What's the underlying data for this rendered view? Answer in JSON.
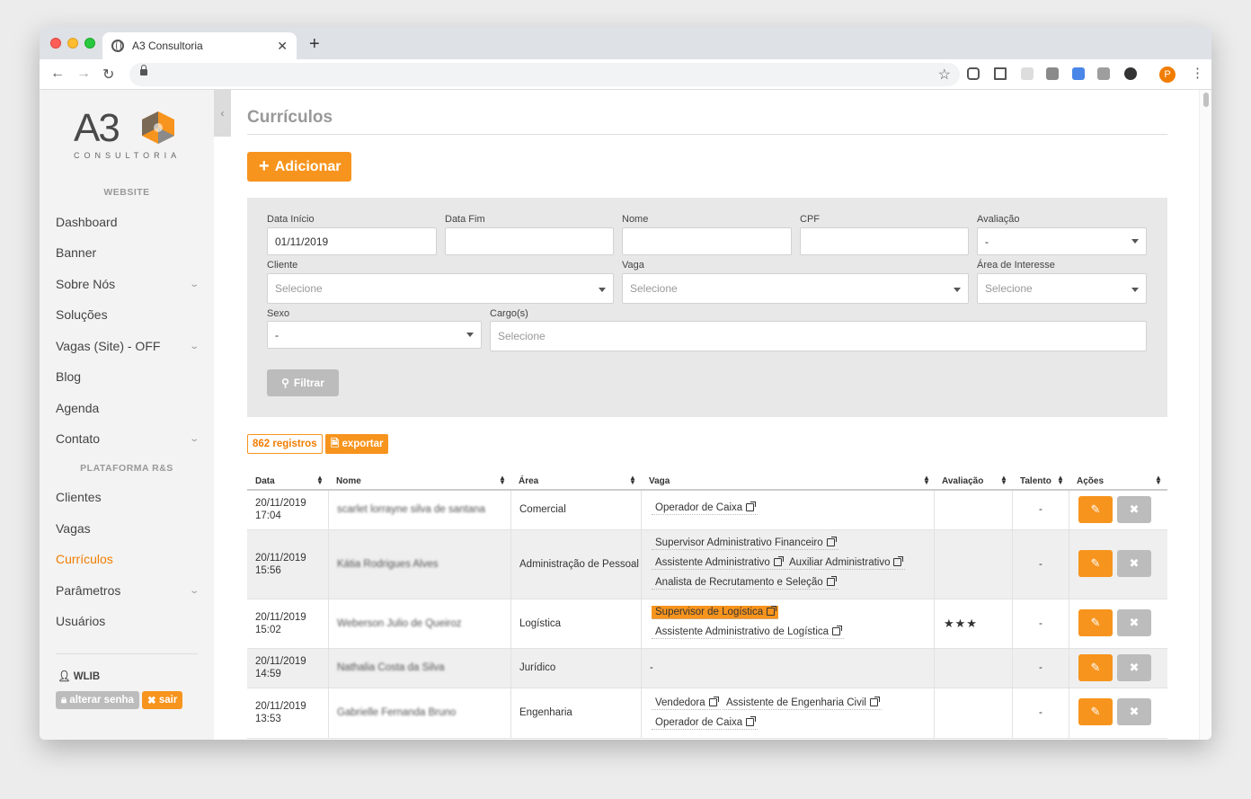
{
  "browser": {
    "tab_title": "A3 Consultoria",
    "tab_close": "✕",
    "new_tab": "+",
    "avatar_letter": "P"
  },
  "logo": {
    "text": "A3",
    "sub": "CONSULTORIA",
    "colors": [
      "#7a6a55",
      "#f7941d",
      "#8a8a8a"
    ]
  },
  "sidebar": {
    "section_website": "WEBSITE",
    "section_platform": "PLATAFORMA R&S",
    "items": [
      {
        "label": "Dashboard",
        "expandable": false
      },
      {
        "label": "Banner",
        "expandable": false
      },
      {
        "label": "Sobre Nós",
        "expandable": true
      },
      {
        "label": "Soluções",
        "expandable": false
      },
      {
        "label": "Vagas (Site) - OFF",
        "expandable": true
      },
      {
        "label": "Blog",
        "expandable": false
      },
      {
        "label": "Agenda",
        "expandable": false
      },
      {
        "label": "Contato",
        "expandable": true
      },
      {
        "label": "Clientes",
        "expandable": false
      },
      {
        "label": "Vagas",
        "expandable": false
      },
      {
        "label": "Currículos",
        "expandable": false,
        "active": true
      },
      {
        "label": "Parâmetros",
        "expandable": true
      },
      {
        "label": "Usuários",
        "expandable": false
      }
    ],
    "user": "WLIB",
    "change_password": "alterar senha",
    "logout": "sair"
  },
  "main": {
    "title": "Currículos",
    "add_button": "Adicionar",
    "accent_color": "#f7941d"
  },
  "filters": {
    "data_inicio": {
      "label": "Data Início",
      "value": "01/11/2019"
    },
    "data_fim": {
      "label": "Data Fim",
      "value": ""
    },
    "nome": {
      "label": "Nome",
      "value": ""
    },
    "cpf": {
      "label": "CPF",
      "value": ""
    },
    "avaliacao": {
      "label": "Avaliação",
      "value": "-"
    },
    "cliente": {
      "label": "Cliente",
      "placeholder": "Selecione"
    },
    "vaga": {
      "label": "Vaga",
      "placeholder": "Selecione"
    },
    "area": {
      "label": "Área de Interesse",
      "placeholder": "Selecione"
    },
    "sexo": {
      "label": "Sexo",
      "value": "-"
    },
    "cargos": {
      "label": "Cargo(s)",
      "placeholder": "Selecione"
    },
    "filter_button": "Filtrar"
  },
  "results": {
    "count": "862 registros",
    "export": "exportar"
  },
  "table": {
    "headers": [
      "Data",
      "Nome",
      "Área",
      "Vaga",
      "Avaliação",
      "Talento",
      "Ações"
    ],
    "rows": [
      {
        "date": "20/11/2019",
        "time": "17:04",
        "name": "scarlet lorrayne silva de santana",
        "area": "Comercial",
        "vagas": [
          [
            "Operador de Caixa"
          ]
        ],
        "rating": "",
        "talent": "-"
      },
      {
        "date": "20/11/2019",
        "time": "15:56",
        "name": "Kátia Rodrigues Alves",
        "area": "Administração de Pessoal",
        "vagas": [
          [
            "Supervisor Administrativo Financeiro"
          ],
          [
            "Assistente Administrativo",
            "Auxiliar Administrativo"
          ],
          [
            "Analista de Recrutamento e Seleção"
          ]
        ],
        "rating": "",
        "talent": "-"
      },
      {
        "date": "20/11/2019",
        "time": "15:02",
        "name": "Weberson Julio de Queiroz",
        "area": "Logística",
        "vagas": [
          [
            "Supervisor de Logística"
          ],
          [
            "Assistente Administrativo de Logística"
          ]
        ],
        "highlight": "Supervisor de Logística",
        "rating": "★★★",
        "talent": "-"
      },
      {
        "date": "20/11/2019",
        "time": "14:59",
        "name": "Nathalia Costa da Silva",
        "area": "Jurídico",
        "vagas_text": "-",
        "rating": "",
        "talent": "-"
      },
      {
        "date": "20/11/2019",
        "time": "13:53",
        "name": "Gabrielle Fernanda Bruno",
        "area": "Engenharia",
        "vagas": [
          [
            "Vendedora",
            "Assistente de Engenharia Civil"
          ],
          [
            "Operador de Caixa"
          ]
        ],
        "rating": "",
        "talent": "-"
      }
    ]
  }
}
